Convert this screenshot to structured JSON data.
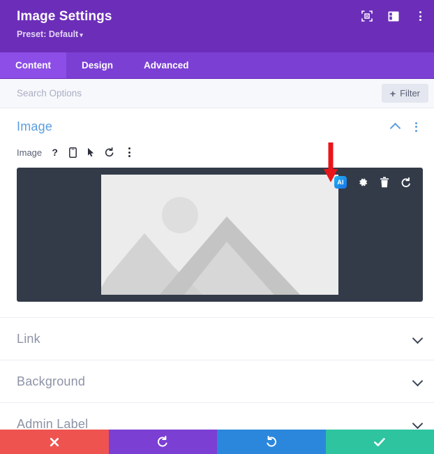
{
  "header": {
    "title": "Image Settings",
    "preset_label": "Preset: Default",
    "preset_caret": "▾",
    "icons": [
      {
        "name": "focus-icon",
        "title": "Focus"
      },
      {
        "name": "layout-icon",
        "title": "Layout"
      },
      {
        "name": "more-options-icon",
        "title": "More Options"
      }
    ]
  },
  "tabs": [
    {
      "label": "Content",
      "active": true
    },
    {
      "label": "Design",
      "active": false
    },
    {
      "label": "Advanced",
      "active": false
    }
  ],
  "search": {
    "placeholder": "Search Options",
    "value": "",
    "filter_label": "Filter",
    "filter_plus": "+"
  },
  "image_section": {
    "title": "Image",
    "field_label": "Image",
    "field_icons": [
      "help-icon",
      "responsive-icon",
      "hover-icon",
      "reset-icon",
      "more-icon"
    ],
    "preview_tools": [
      {
        "name": "ai-badge",
        "label": "AI"
      },
      {
        "name": "settings-gear-icon",
        "label": ""
      },
      {
        "name": "trash-icon",
        "label": ""
      },
      {
        "name": "undo-icon",
        "label": ""
      }
    ]
  },
  "collapsed_sections": [
    {
      "title": "Link"
    },
    {
      "title": "Background"
    },
    {
      "title": "Admin Label"
    }
  ],
  "bottom_bar": [
    {
      "name": "cancel-button",
      "glyph": "✕",
      "color": "#ef5350"
    },
    {
      "name": "undo-button",
      "glyph": "↺",
      "color": "#7b3fd4"
    },
    {
      "name": "redo-button",
      "glyph": "↻",
      "color": "#2b87db"
    },
    {
      "name": "save-button",
      "glyph": "✔",
      "color": "#2ec4a0"
    }
  ],
  "annotation": {
    "arrow_color": "#e8151b",
    "arrow_points_to": "ai-badge"
  },
  "colors": {
    "header_purple": "#6c2eb9",
    "tab_purple": "#7b3fd4",
    "tab_active_purple": "#8c4ee6",
    "section_blue": "#5b9de0",
    "preview_dark": "#333b49"
  }
}
